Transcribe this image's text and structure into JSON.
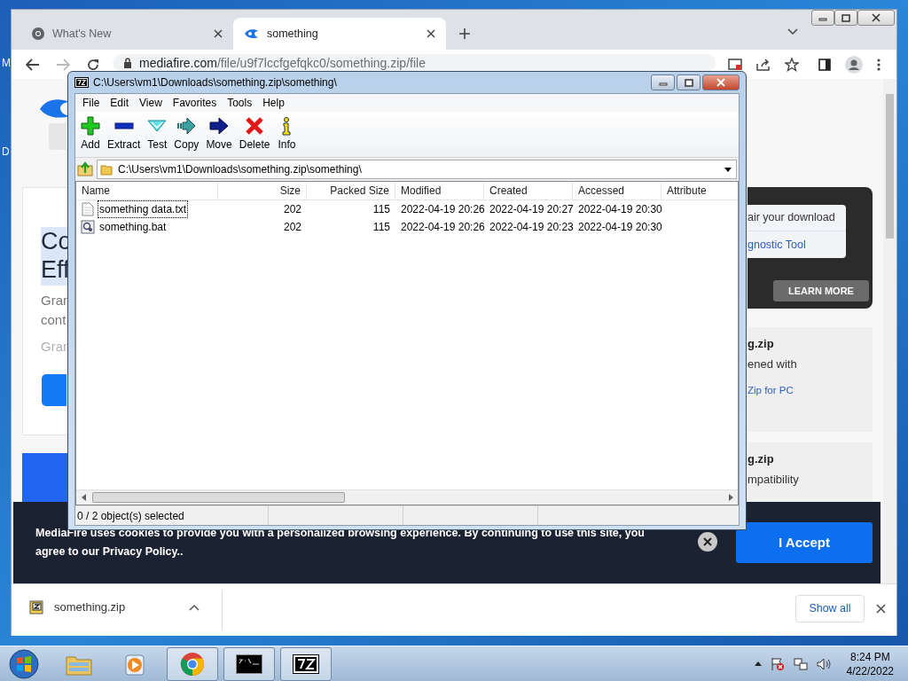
{
  "desktop": {
    "icon_labels": [
      "M",
      "D"
    ]
  },
  "browser": {
    "tabs": [
      {
        "title": "What's New",
        "kind": "chrome",
        "selected": false
      },
      {
        "title": "something",
        "kind": "mediafire",
        "selected": true
      }
    ],
    "url": {
      "domain": "mediafire.com",
      "path": "/file/u9f7lccfgefqkc0/something.zip/file"
    },
    "page": {
      "left_fragments": [
        {
          "text": "Co",
          "kind": "heading"
        },
        {
          "text": "Eff",
          "kind": "heading"
        },
        {
          "text": "Gran",
          "kind": "body"
        },
        {
          "text": "cont",
          "kind": "body"
        },
        {
          "text": "Gran",
          "kind": "faint"
        }
      ],
      "promo": {
        "lines": [
          {
            "text": "air your download",
            "kind": "plain"
          },
          {
            "text": "gnostic Tool",
            "kind": "link"
          }
        ],
        "button": "LEARN MORE"
      },
      "cards": [
        {
          "lines": [
            {
              "text": "g.zip",
              "kind": "title"
            },
            {
              "text": "ened with",
              "kind": "plain"
            },
            {
              "text": "Zip for PC",
              "kind": "link"
            }
          ]
        },
        {
          "lines": [
            {
              "text": "g.zip",
              "kind": "title"
            },
            {
              "text": "mpatibility",
              "kind": "plain"
            }
          ]
        }
      ]
    },
    "cookie_banner": {
      "text": "MediaFire uses cookies to provide you with a personalized browsing experience. By continuing to use this site, you agree to our Privacy Policy..",
      "button": "I Accept"
    },
    "downloads": [
      {
        "name": "something.zip"
      }
    ],
    "show_all": "Show all"
  },
  "archive_window": {
    "title": "C:\\Users\\vm1\\Downloads\\something.zip\\something\\",
    "menu": [
      "File",
      "Edit",
      "View",
      "Favorites",
      "Tools",
      "Help"
    ],
    "toolbar": [
      {
        "label": "Add",
        "kind": "add"
      },
      {
        "label": "Extract",
        "kind": "extract"
      },
      {
        "label": "Test",
        "kind": "test"
      },
      {
        "label": "Copy",
        "kind": "copy"
      },
      {
        "label": "Move",
        "kind": "move"
      },
      {
        "label": "Delete",
        "kind": "delete"
      },
      {
        "label": "Info",
        "kind": "info"
      }
    ],
    "path": "C:\\Users\\vm1\\Downloads\\something.zip\\something\\",
    "columns": [
      "Name",
      "Size",
      "Packed Size",
      "Modified",
      "Created",
      "Accessed",
      "Attribute"
    ],
    "rows": [
      {
        "kind": "text",
        "focused": true,
        "cells": [
          "something data.txt",
          "202",
          "115",
          "2022-04-19 20:26",
          "2022-04-19 20:27",
          "2022-04-19 20:30"
        ]
      },
      {
        "kind": "script",
        "focused": false,
        "cells": [
          "something.bat",
          "202",
          "115",
          "2022-04-19 20:26",
          "2022-04-19 20:23",
          "2022-04-19 20:30"
        ]
      }
    ],
    "status": "0 / 2 object(s) selected"
  },
  "taskbar": {
    "apps": [
      {
        "kind": "explorer",
        "running": false
      },
      {
        "kind": "media",
        "running": false
      },
      {
        "kind": "chrome",
        "running": true
      },
      {
        "kind": "console",
        "running": true
      },
      {
        "kind": "archiver",
        "running": true
      }
    ],
    "time": "8:24 PM",
    "date": "4/22/2022"
  }
}
